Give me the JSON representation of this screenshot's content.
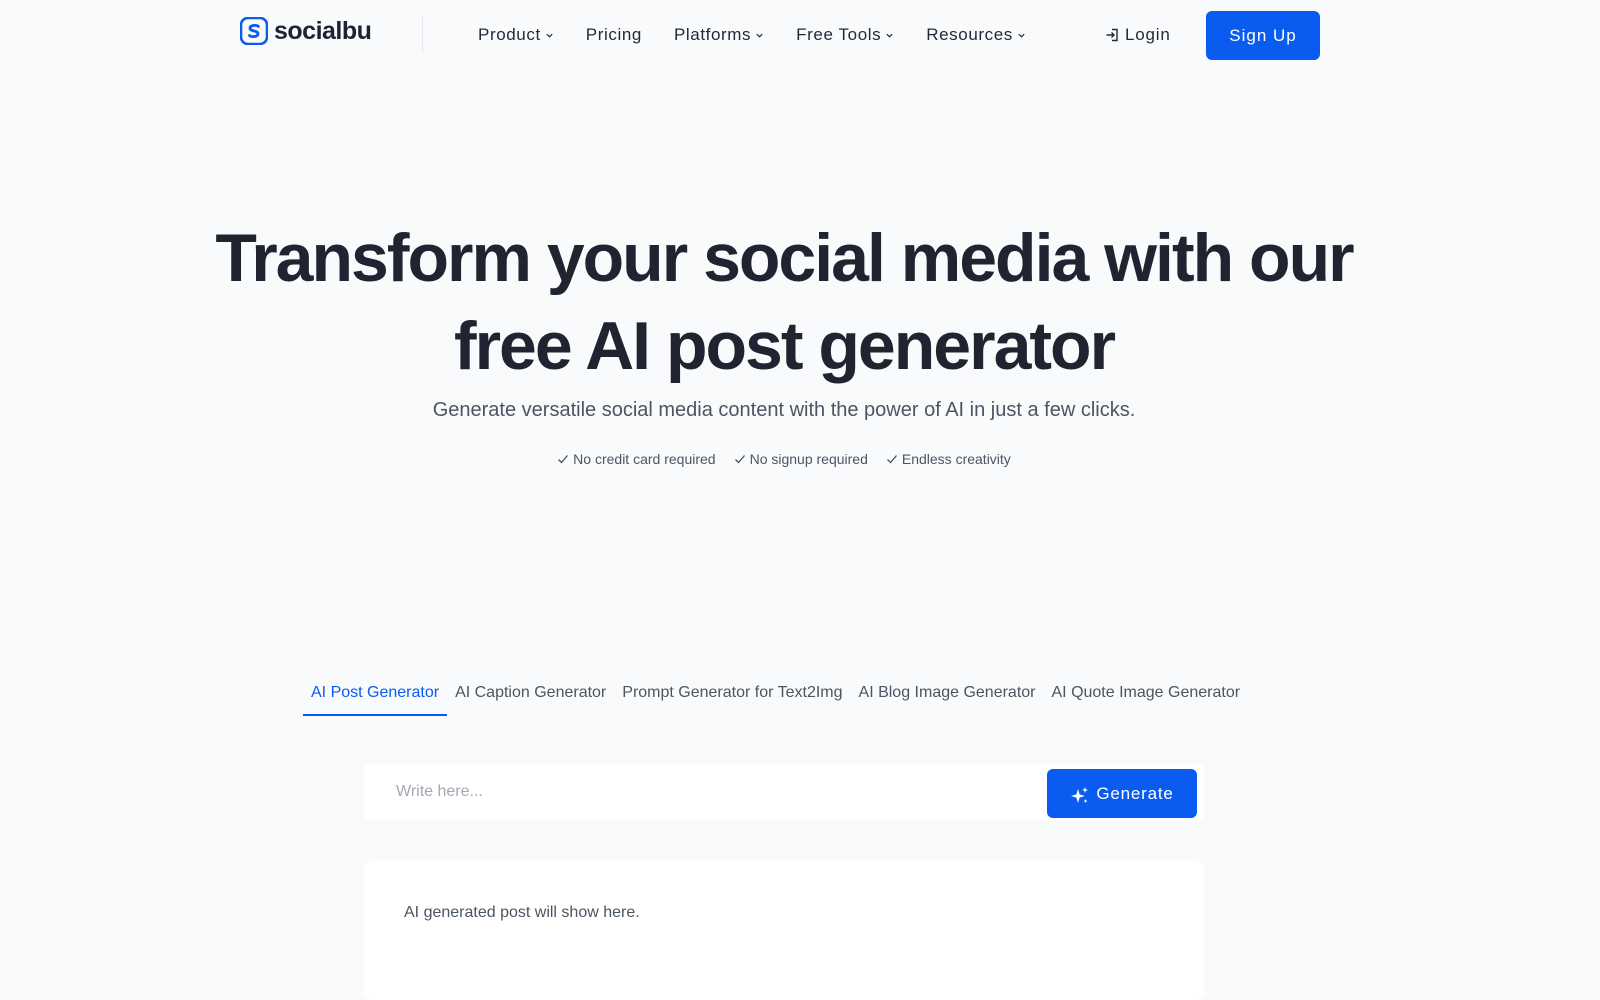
{
  "brand": {
    "name": "socialbu",
    "color": "#0a5cf0",
    "logo_icon": "socialbu-s-logo-icon"
  },
  "nav": {
    "items": [
      {
        "label": "Product",
        "dropdown": true
      },
      {
        "label": "Pricing",
        "dropdown": false
      },
      {
        "label": "Platforms",
        "dropdown": true
      },
      {
        "label": "Free Tools",
        "dropdown": true
      },
      {
        "label": "Resources",
        "dropdown": true
      }
    ],
    "login_label": "Login",
    "signup_label": "Sign Up"
  },
  "hero": {
    "title_line1": "Transform your social media with our",
    "title_line2": "free AI post generator",
    "subtitle": "Generate versatile social media content with the power of AI in just a few clicks.",
    "checks": [
      "No credit card required",
      "No signup required",
      "Endless creativity"
    ]
  },
  "tabs": {
    "items": [
      {
        "label": "AI Post Generator",
        "active": true
      },
      {
        "label": "AI Caption Generator",
        "active": false
      },
      {
        "label": "Prompt Generator for Text2Img",
        "active": false
      },
      {
        "label": "AI Blog Image Generator",
        "active": false
      },
      {
        "label": "AI Quote Image Generator",
        "active": false
      }
    ]
  },
  "generator": {
    "input_value": "",
    "input_placeholder": "Write here...",
    "generate_label": "Generate",
    "output_placeholder": "AI generated post will show here."
  }
}
